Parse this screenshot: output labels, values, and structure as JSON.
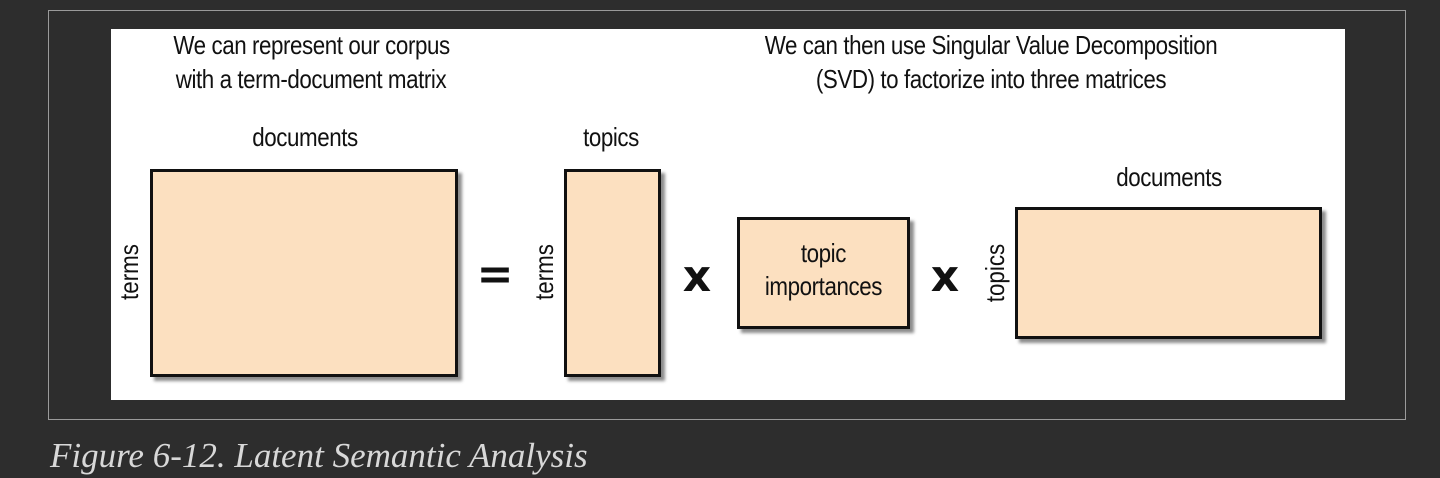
{
  "diagram": {
    "left_heading": {
      "line1": "We can represent our corpus",
      "line2": "with a term-document matrix"
    },
    "right_heading": {
      "line1": "We can then use Singular Value Decomposition",
      "line2": "(SVD) to factorize into three matrices"
    },
    "term_document_matrix": {
      "top_label": "documents",
      "side_label": "terms"
    },
    "equals_symbol": "=",
    "term_topic_matrix": {
      "top_label": "topics",
      "side_label": "terms"
    },
    "multiply_symbol_1": "x",
    "topic_importances_matrix": {
      "label_line1": "topic",
      "label_line2": "importances"
    },
    "multiply_symbol_2": "x",
    "topic_document_matrix": {
      "top_label": "documents",
      "side_label": "topics"
    },
    "colors": {
      "matrix_fill": "#fce0c0",
      "matrix_border": "#111111",
      "page_background": "#2d2d2d",
      "diagram_background": "#ffffff",
      "caption_text": "#d8d8d8"
    }
  },
  "caption": "Figure 6-12. Latent Semantic Analysis"
}
